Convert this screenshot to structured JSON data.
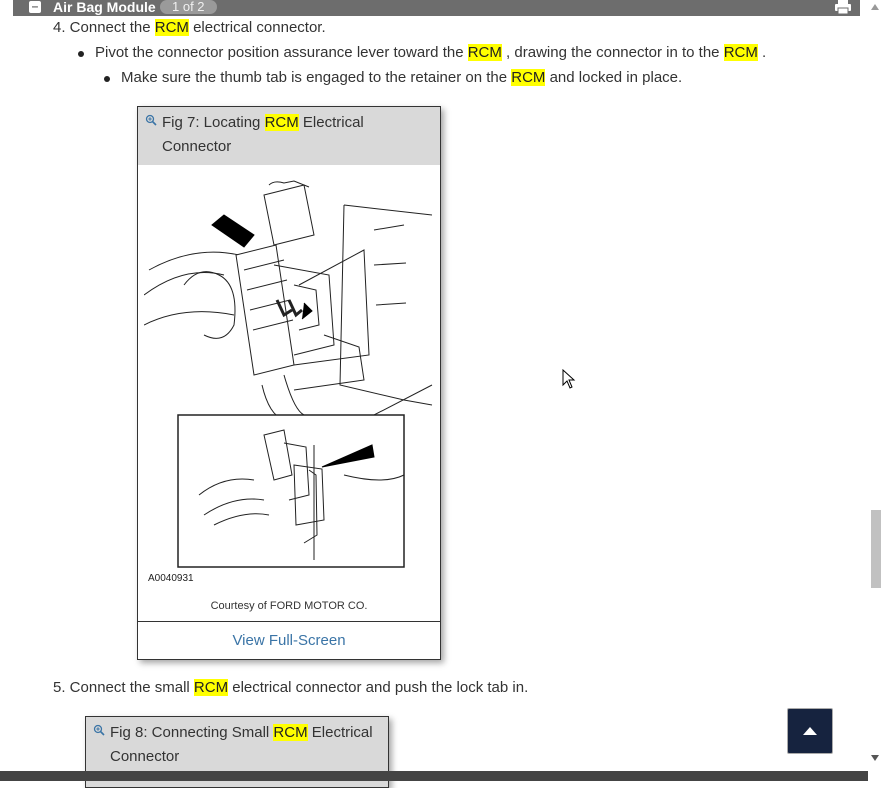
{
  "header": {
    "collapse_symbol": "–",
    "title": "Air Bag Module",
    "pager": "1 of 2",
    "print_icon": "printer-icon"
  },
  "step4": {
    "prefix": "4. Connect the ",
    "hl": "RCM",
    "suffix": " electrical connector.",
    "bullet1": {
      "a": "Pivot the connector position assurance lever toward the ",
      "hl1": "RCM",
      "b": " , drawing the connector in to the ",
      "hl2": "RCM",
      "c": " ."
    },
    "bullet2": {
      "a": "Make sure the thumb tab is engaged to the retainer on the ",
      "hl": "RCM",
      "b": " and locked in place."
    }
  },
  "fig7": {
    "cap_a": "Fig 7: Locating ",
    "cap_hl": "RCM",
    "cap_b": " Electrical",
    "cap_line2": "Connector",
    "ref": "A0040931",
    "courtesy": "Courtesy of FORD MOTOR CO.",
    "fullscreen": "View Full-Screen"
  },
  "step5": {
    "prefix": "5. Connect the small ",
    "hl": "RCM",
    "suffix": " electrical connector and push the lock tab in."
  },
  "fig8": {
    "cap_a": "Fig 8: Connecting Small ",
    "cap_hl": "RCM",
    "cap_b": " Electrical",
    "cap_line2": "Connector"
  },
  "colors": {
    "highlight": "#ffff00",
    "link": "#3a74a6",
    "header_bg": "#6d6d6d",
    "back_to_top": "#16233f"
  }
}
